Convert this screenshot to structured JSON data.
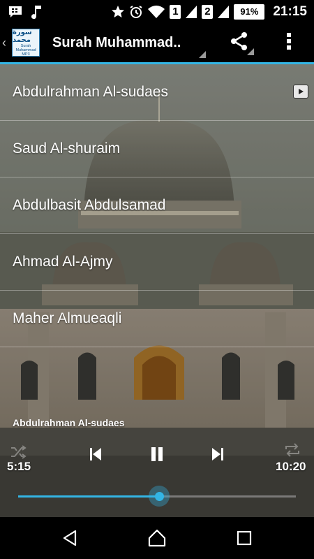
{
  "status_bar": {
    "left_icons": [
      "bbm-icon",
      "music-note-icon"
    ],
    "right_icons": [
      "star-icon",
      "alarm-icon",
      "wifi-icon",
      "sim1-signal-icon",
      "sim2-signal-icon",
      "battery-icon"
    ],
    "sim1_label": "1",
    "sim2_label": "2",
    "battery_percent": "91%",
    "time": "21:15"
  },
  "action_bar": {
    "app_icon_arabic": "سورة محمد",
    "app_icon_line1": "Surah",
    "app_icon_line2": "Muhammad MP3",
    "title": "Surah Muhammad..",
    "share_icon": "share-icon",
    "overflow_icon": "overflow-menu-icon"
  },
  "reciters": [
    {
      "label": "Abdulrahman Al-sudaes",
      "playing": true
    },
    {
      "label": "Saud Al-shuraim",
      "playing": false
    },
    {
      "label": "Abdulbasit Abdulsamad",
      "playing": false
    },
    {
      "label": "Ahmad Al-Ajmy",
      "playing": false
    },
    {
      "label": "Maher Almueaqli",
      "playing": false
    }
  ],
  "player": {
    "now_playing": "Abdulrahman Al-sudaes",
    "elapsed": "5:15",
    "duration": "10:20",
    "progress_fraction": 0.508,
    "controls": [
      "shuffle-icon",
      "previous-icon",
      "pause-icon",
      "next-icon",
      "repeat-icon"
    ]
  },
  "nav_bar": {
    "buttons": [
      "back-icon",
      "home-icon",
      "recents-icon"
    ]
  },
  "colors": {
    "accent": "#33b5e5",
    "bar_background": "#000000"
  }
}
